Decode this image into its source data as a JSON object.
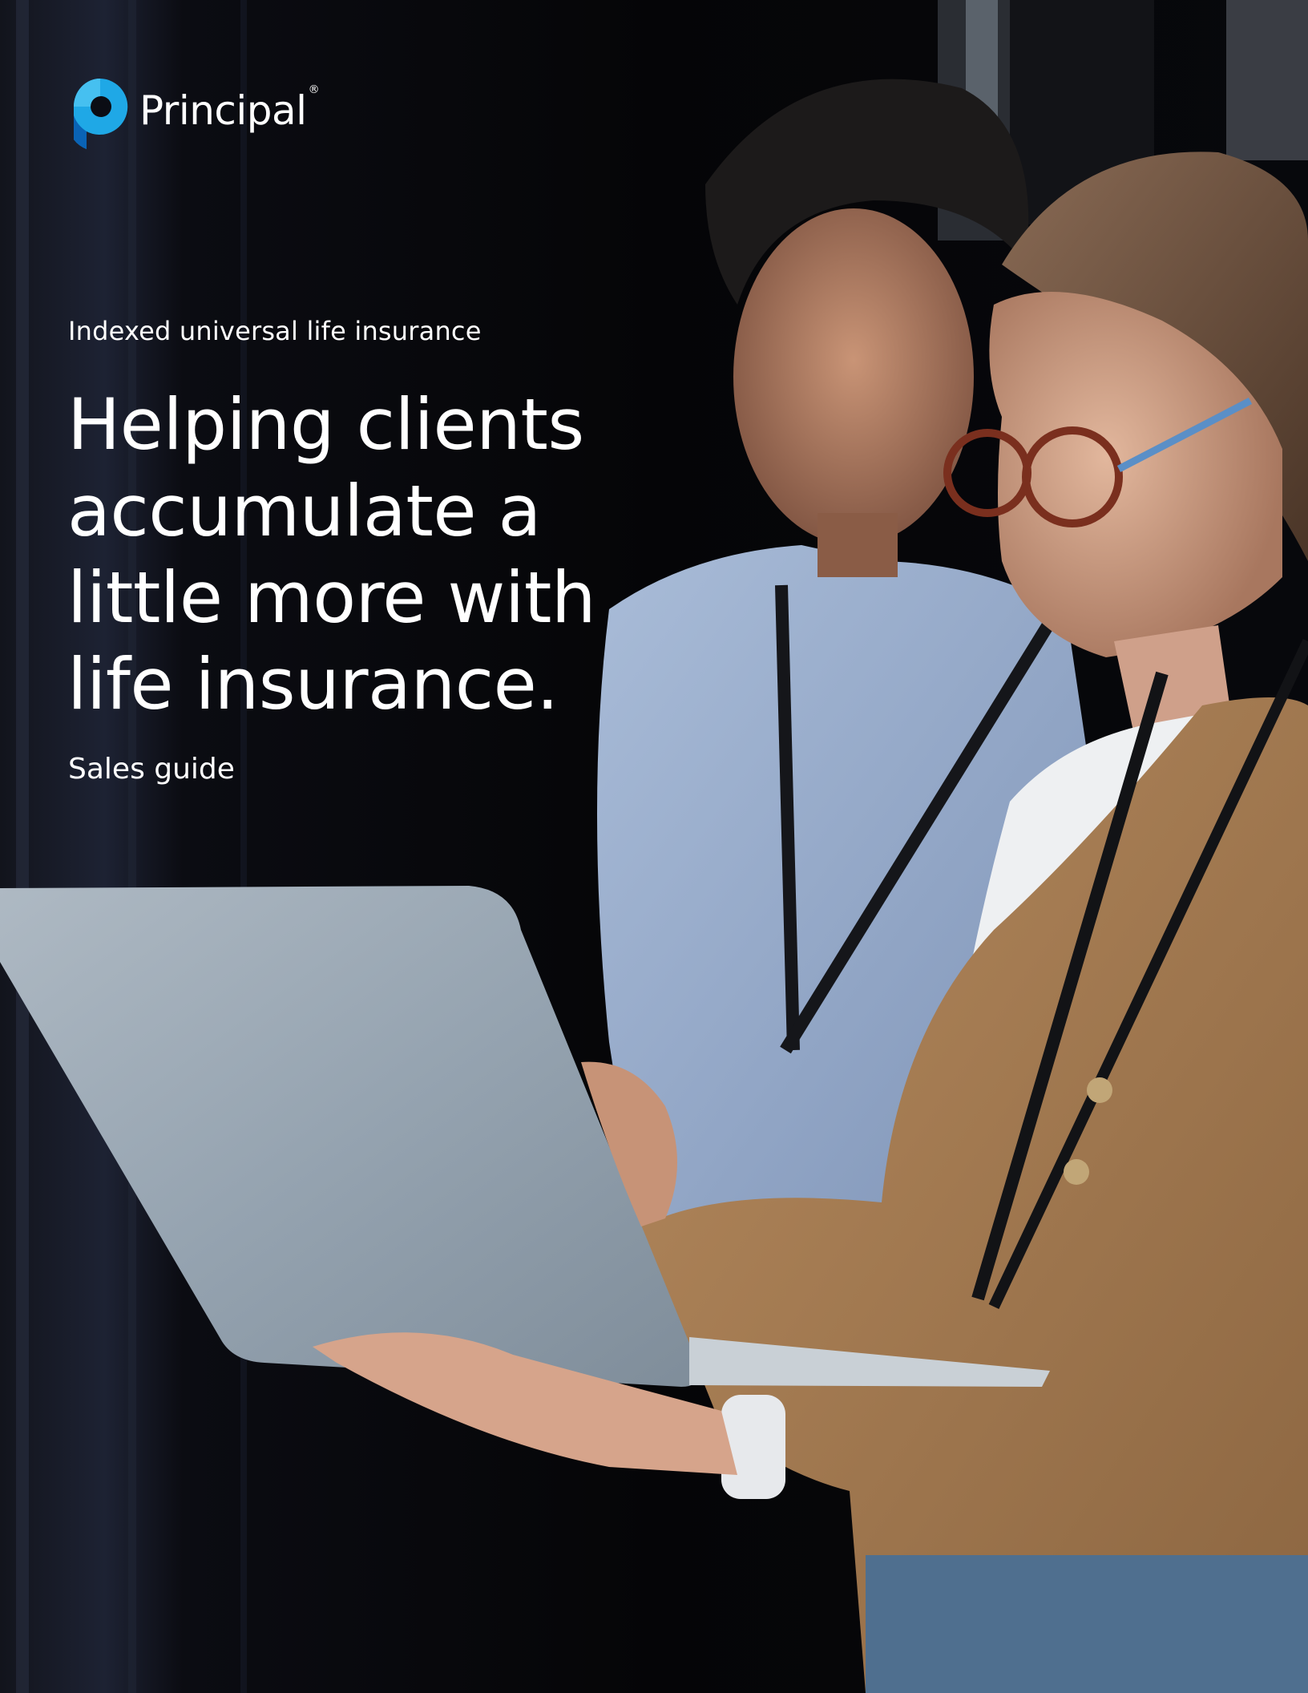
{
  "brand": {
    "name": "Principal",
    "registered_mark": "®",
    "logo_icon": "principal-p-icon",
    "colors": {
      "logo_light_blue": "#1fa8e6",
      "logo_dark_blue": "#0a63b5",
      "text": "#ffffff",
      "background": "#060608"
    }
  },
  "cover": {
    "eyebrow": "Indexed universal life insurance",
    "headline": "Helping clients accumulate a little more with life insurance.",
    "subtitle": "Sales guide"
  }
}
